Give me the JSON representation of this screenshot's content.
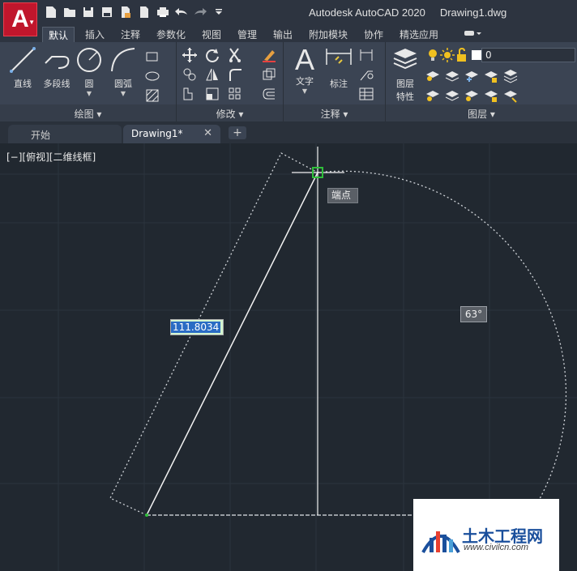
{
  "window": {
    "app_name": "Autodesk AutoCAD 2020",
    "document_name": "Drawing1.dwg",
    "logo_letter": "A"
  },
  "ribbon_tabs": [
    "默认",
    "插入",
    "注释",
    "参数化",
    "视图",
    "管理",
    "输出",
    "附加模块",
    "协作",
    "精选应用"
  ],
  "active_ribbon_tab": "默认",
  "ribbon": {
    "draw": {
      "panel_label": "绘图 ▾",
      "line": "直线",
      "polyline": "多段线",
      "circle": "圆",
      "arc": "圆弧"
    },
    "modify": {
      "panel_label": "修改 ▾"
    },
    "annotation": {
      "panel_label": "注释 ▾",
      "text": "文字",
      "dimension": "标注"
    },
    "layers": {
      "panel_label": "图层 ▾",
      "properties_line1": "图层",
      "properties_line2": "特性",
      "current_layer": "0"
    }
  },
  "doc_tabs": {
    "start": "开始",
    "active": "Drawing1*",
    "close_glyph": "✕",
    "new_glyph": "+"
  },
  "viewport": {
    "label": "[−][俯视][二维线框]",
    "osnap_tooltip": "端点",
    "length_input": "111.8034",
    "angle_tooltip": "63°"
  },
  "watermark": {
    "brand": "土木工程网",
    "url": "www.civilcn.com"
  },
  "colors": {
    "canvas": "#212830",
    "ribbon": "#3b4453",
    "accent_red": "#c0162c",
    "osnap_green": "#2fbf3a"
  }
}
